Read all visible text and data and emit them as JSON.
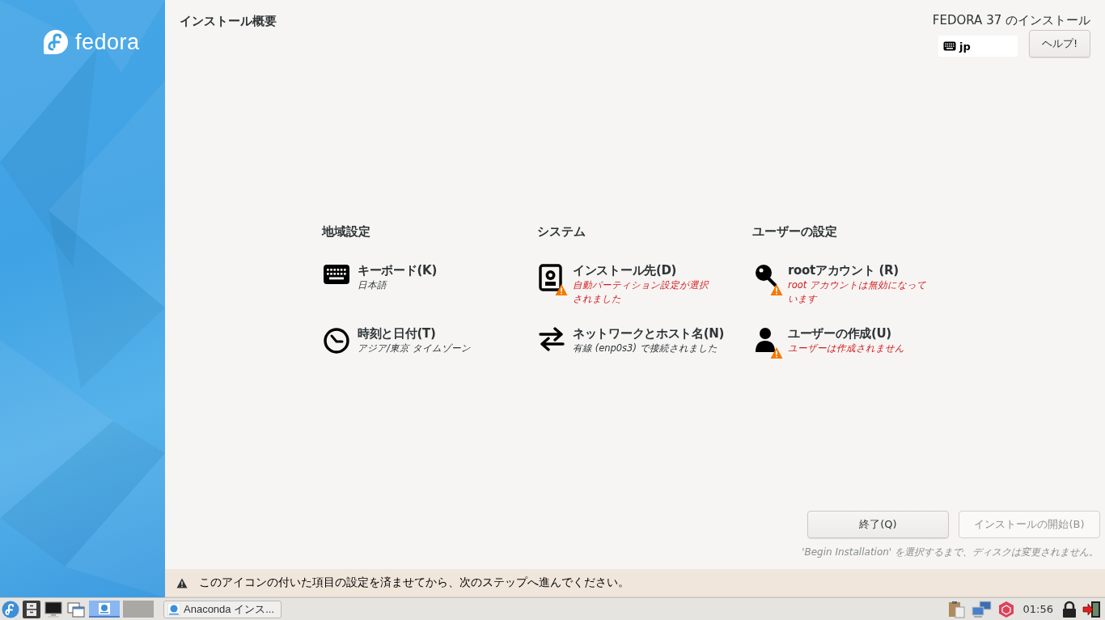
{
  "sidebar": {
    "logo_text": "fedora"
  },
  "header": {
    "title": "インストール概要",
    "product": "FEDORA 37 のインストール",
    "keyboard_layout": "jp",
    "help_button": "ヘルプ!"
  },
  "hub": [
    {
      "category": "地域設定",
      "spokes": [
        {
          "kind": "keyboard",
          "title": "キーボード(K)",
          "status": "日本語",
          "warning": false
        },
        {
          "kind": "clock",
          "title": "時刻と日付(T)",
          "status": "アジア/東京 タイムゾーン",
          "warning": false
        }
      ]
    },
    {
      "category": "システム",
      "spokes": [
        {
          "kind": "disk",
          "title": "インストール先(D)",
          "status": "自動パーティション設定が選択されました",
          "warning": true
        },
        {
          "kind": "network",
          "title": "ネットワークとホスト名(N)",
          "status": "有線 (enp0s3) で接続されました",
          "warning": false
        }
      ]
    },
    {
      "category": "ユーザーの設定",
      "spokes": [
        {
          "kind": "key",
          "title": "rootアカウント (R)",
          "status": "root アカウントは無効になっています",
          "warning": true
        },
        {
          "kind": "user",
          "title": "ユーザーの作成(U)",
          "status": "ユーザーは作成されません",
          "warning": true
        }
      ]
    }
  ],
  "buttons": [
    {
      "label": "終了(Q)",
      "disabled": false
    },
    {
      "label": "インストールの開始(B)",
      "disabled": true
    }
  ],
  "disk_note": "'Begin Installation' を選択するまで、ディスクは変更されません。",
  "warning_bar": {
    "text": "このアイコンの付いた項目の設定を済ませてから、次のステップへ進んでください。"
  },
  "taskbar": {
    "workspaces": [
      {
        "selected": true
      },
      {
        "selected": false
      }
    ],
    "task": "Anaconda インス...",
    "clock": "01:56"
  }
}
